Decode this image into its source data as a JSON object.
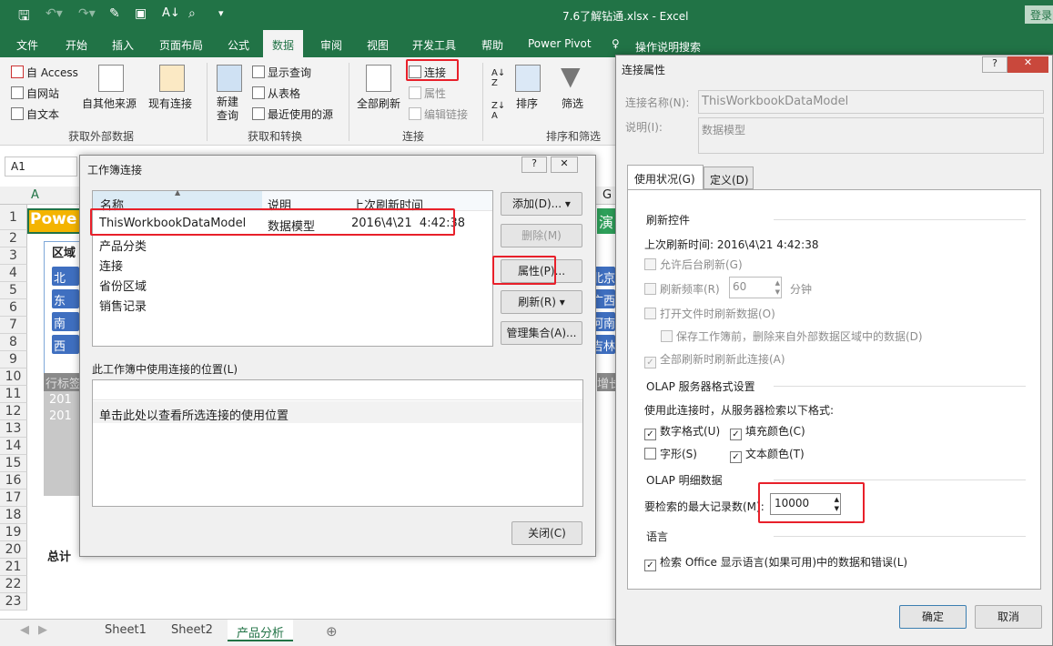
{
  "window": {
    "title": "7.6了解钻通.xlsx - Excel",
    "login": "登录",
    "accent": "#217346"
  },
  "ribbon_tabs": [
    "文件",
    "开始",
    "插入",
    "页面布局",
    "公式",
    "数据",
    "审阅",
    "视图",
    "开发工具",
    "帮助",
    "Power Pivot",
    "操作说明搜索"
  ],
  "ribbon": {
    "ext": {
      "access": "自 Access",
      "web": "自网站",
      "text": "自文本",
      "other": "自其他来源",
      "existing": "现有连接",
      "group": "获取外部数据"
    },
    "transform": {
      "new_query": "新建\n查询",
      "show": "显示查询",
      "table": "从表格",
      "recent": "最近使用的源",
      "group": "获取和转换"
    },
    "conn": {
      "refresh_all": "全部刷新",
      "connections": "连接",
      "properties": "属性",
      "edit_links": "编辑链接",
      "group": "连接"
    },
    "sort": {
      "sort": "排序",
      "filter": "筛选",
      "group": "排序和筛选"
    }
  },
  "namebox": "A1",
  "sheet": {
    "col_a": "A",
    "col_g": "G",
    "row_numbers": [
      "1",
      "2",
      "3",
      "4",
      "5",
      "6",
      "7",
      "8",
      "9",
      "10",
      "11",
      "12",
      "13",
      "14",
      "15",
      "16",
      "17",
      "18",
      "19",
      "20",
      "21",
      "22",
      "23"
    ],
    "a1": "Powe",
    "region": "区域",
    "slicer_left": [
      "北",
      "东",
      "南",
      "西"
    ],
    "slicer_right": [
      "北京",
      "广西",
      "河南",
      "吉林"
    ],
    "row_label": "行标签",
    "y11": "201",
    "y12": "201",
    "total": "总计",
    "g1": "演",
    "growth": "增长"
  },
  "sheet_tabs": [
    "Sheet1",
    "Sheet2",
    "产品分析"
  ],
  "wb_dialog": {
    "title": "工作簿连接",
    "headers": [
      "名称",
      "说明",
      "上次刷新时间"
    ],
    "rows": [
      {
        "name": "ThisWorkbookDataModel",
        "desc": "数据模型",
        "time": "2016\\4\\21  4:42:38"
      },
      {
        "name": "产品分类"
      },
      {
        "name": "连接"
      },
      {
        "name": "省份区域"
      },
      {
        "name": "销售记录"
      }
    ],
    "buttons": {
      "add": "添加(D)...",
      "delete": "删除(M)",
      "properties": "属性(P)...",
      "refresh": "刷新(R)",
      "manage": "管理集合(A)...",
      "close": "关闭(C)"
    },
    "usage_label": "此工作簿中使用连接的位置(L)",
    "usage_hint": "单击此处以查看所选连接的使用位置"
  },
  "props_dialog": {
    "title": "连接属性",
    "name_label": "连接名称(N):",
    "name_value": "ThisWorkbookDataModel",
    "desc_label": "说明(I):",
    "desc_value": "数据模型",
    "tabs": [
      "使用状况(G)",
      "定义(D)"
    ],
    "refresh_section": "刷新控件",
    "last_refresh": "上次刷新时间:  2016\\4\\21   4:42:38",
    "bg_refresh": "允许后台刷新(G)",
    "refresh_every": "刷新频率(R)",
    "refresh_minutes": "60",
    "minutes_unit": "分钟",
    "refresh_on_open": "打开文件时刷新数据(O)",
    "remove_data": "保存工作簿前，删除来自外部数据区域中的数据(D)",
    "refresh_all": "全部刷新时刷新此连接(A)",
    "olap_section": "OLAP 服务器格式设置",
    "olap_intro": "使用此连接时，从服务器检索以下格式:",
    "number_format": {
      "label": "数字格式(U)",
      "checked": true
    },
    "fill_color": {
      "label": "填充颜色(C)",
      "checked": true
    },
    "font_style": {
      "label": "字形(S)",
      "checked": false
    },
    "text_color": {
      "label": "文本颜色(T)",
      "checked": true
    },
    "drill_section": "OLAP 明细数据",
    "max_records_label": "要检索的最大记录数(M):",
    "max_records": "10000",
    "lang_section": "语言",
    "lang_option": {
      "label": "检索 Office 显示语言(如果可用)中的数据和错误(L)",
      "checked": true
    },
    "ok": "确定",
    "cancel": "取消"
  }
}
